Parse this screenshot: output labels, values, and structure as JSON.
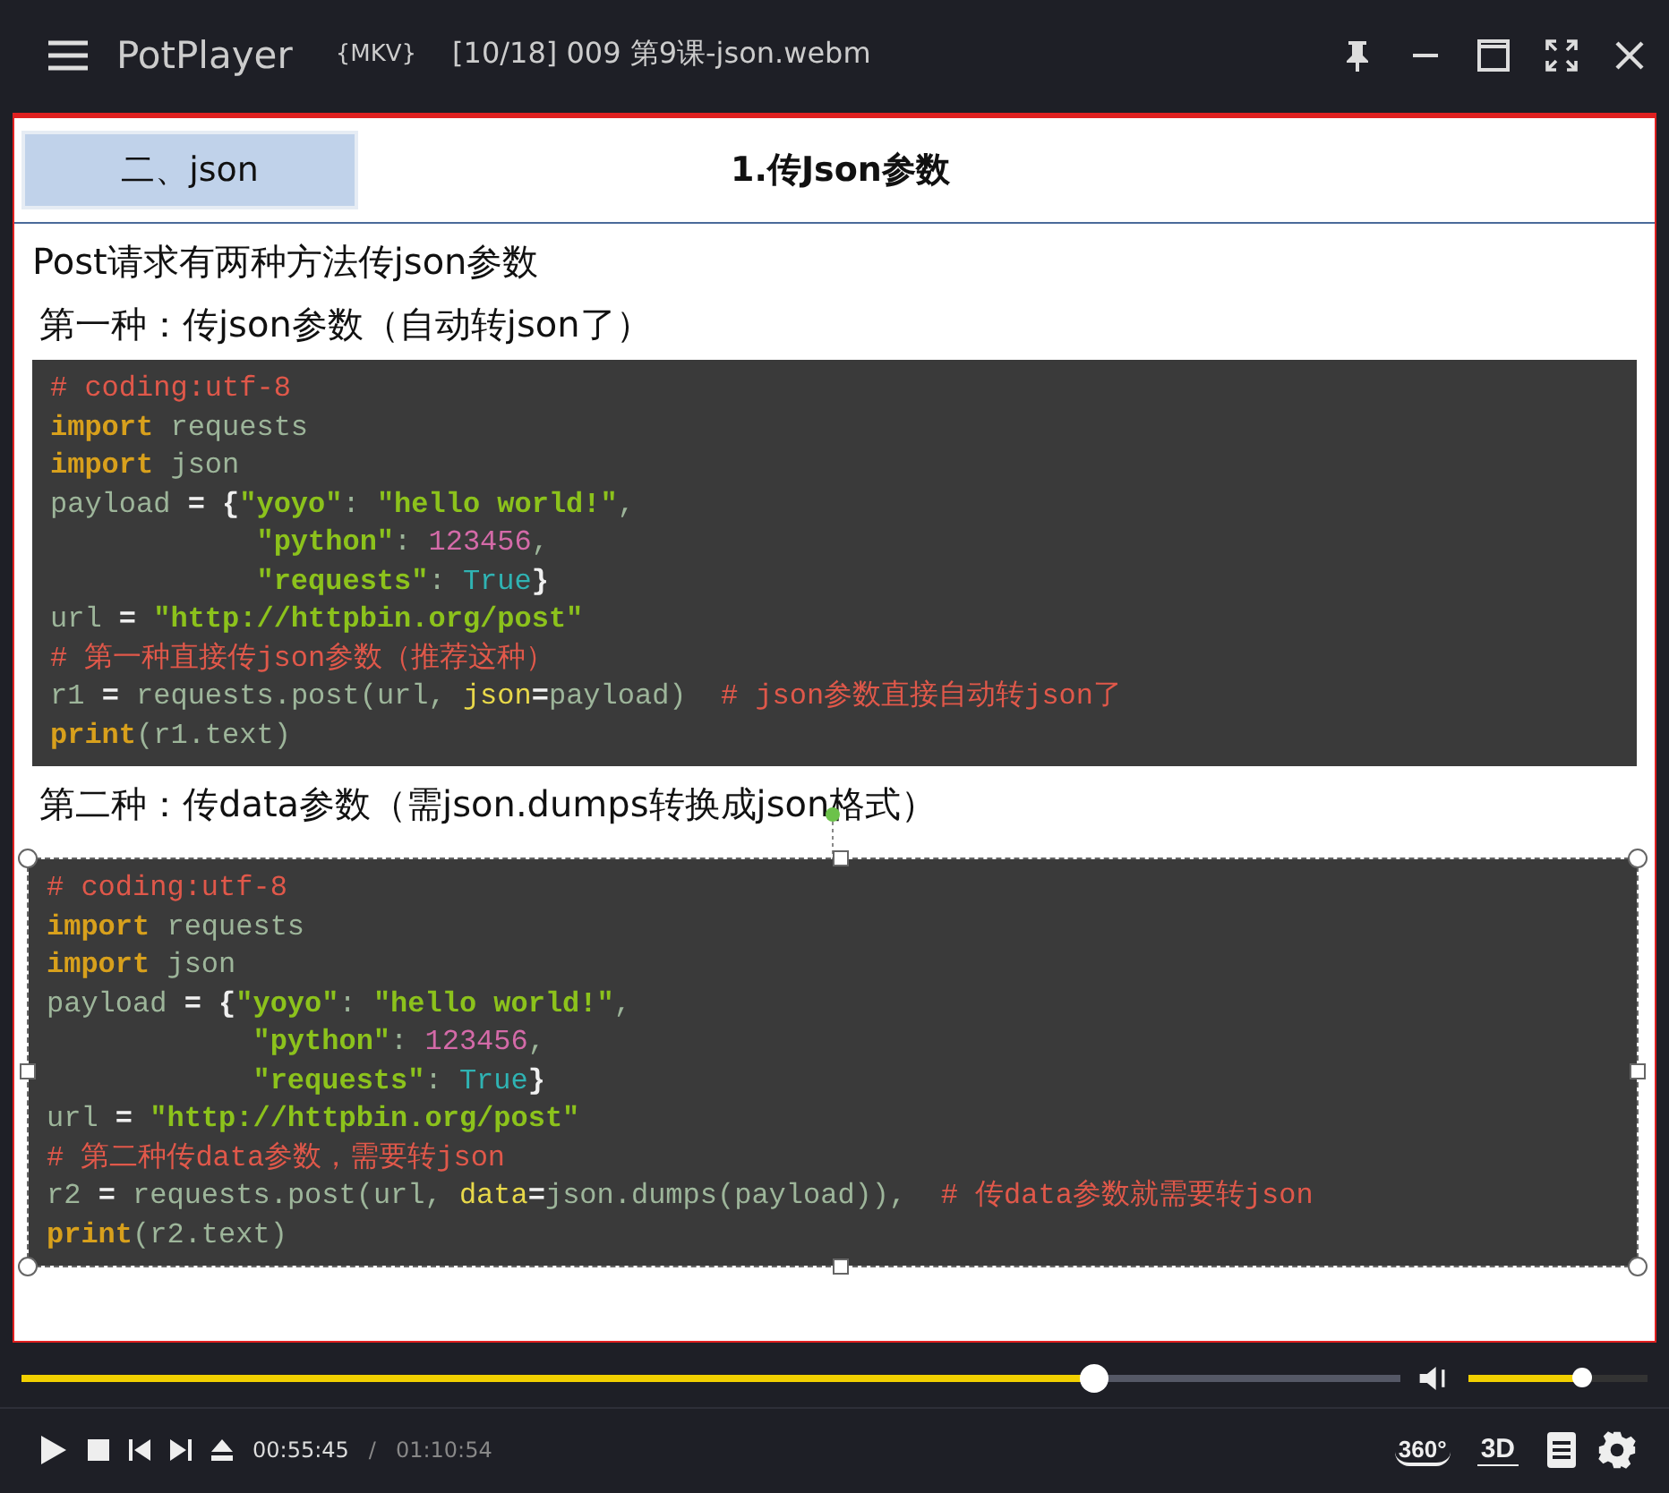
{
  "window": {
    "app_name": "PotPlayer",
    "format": "{MKV}",
    "title": "[10/18] 009 第9课-json.webm"
  },
  "slide": {
    "section": "二、json",
    "heading": "1.传Json参数",
    "intro": "Post请求有两种方法传json参数",
    "blocks": [
      {
        "label": "第一种：传json参数（自动转json了）",
        "selected": false,
        "lines": [
          {
            "indented": false,
            "tokens": [
              {
                "kind": "comment",
                "text": "# coding:utf-8"
              }
            ]
          },
          {
            "indented": false,
            "tokens": [
              {
                "kind": "keyword",
                "text": "import"
              },
              {
                "kind": "plain",
                "text": " requests"
              }
            ]
          },
          {
            "indented": false,
            "tokens": [
              {
                "kind": "keyword",
                "text": "import"
              },
              {
                "kind": "plain",
                "text": " json"
              }
            ]
          },
          {
            "indented": false,
            "tokens": [
              {
                "kind": "plain",
                "text": "payload "
              },
              {
                "kind": "operator",
                "text": "= {"
              },
              {
                "kind": "string",
                "text": "\"yoyo\""
              },
              {
                "kind": "plain",
                "text": ": "
              },
              {
                "kind": "string",
                "text": "\"hello world!\""
              },
              {
                "kind": "plain",
                "text": ","
              }
            ]
          },
          {
            "indented": true,
            "tokens": [
              {
                "kind": "string",
                "text": "\"python\""
              },
              {
                "kind": "plain",
                "text": ": "
              },
              {
                "kind": "number",
                "text": "123456"
              },
              {
                "kind": "plain",
                "text": ","
              }
            ]
          },
          {
            "indented": true,
            "tokens": [
              {
                "kind": "string",
                "text": "\"requests\""
              },
              {
                "kind": "plain",
                "text": ": "
              },
              {
                "kind": "constant",
                "text": "True"
              },
              {
                "kind": "operator",
                "text": "}"
              }
            ]
          },
          {
            "indented": false,
            "tokens": [
              {
                "kind": "plain",
                "text": "url "
              },
              {
                "kind": "operator",
                "text": "= "
              },
              {
                "kind": "string",
                "text": "\"http://httpbin.org/post\""
              }
            ]
          },
          {
            "indented": false,
            "tokens": [
              {
                "kind": "comment",
                "text": "# 第一种直接传json参数（推荐这种）"
              }
            ]
          },
          {
            "indented": false,
            "tokens": [
              {
                "kind": "plain",
                "text": "r1 "
              },
              {
                "kind": "operator",
                "text": "="
              },
              {
                "kind": "plain",
                "text": " requests.post(url, "
              },
              {
                "kind": "param",
                "text": "json"
              },
              {
                "kind": "operator",
                "text": "="
              },
              {
                "kind": "plain",
                "text": "payload)  "
              },
              {
                "kind": "comment",
                "text": "# json参数直接自动转json了"
              }
            ]
          },
          {
            "indented": false,
            "tokens": [
              {
                "kind": "keyword",
                "text": "print"
              },
              {
                "kind": "plain",
                "text": "(r1.text)"
              }
            ]
          }
        ]
      },
      {
        "label": "第二种：传data参数（需json.dumps转换成json格式）",
        "selected": true,
        "lines": [
          {
            "indented": false,
            "tokens": [
              {
                "kind": "comment",
                "text": "# coding:utf-8"
              }
            ]
          },
          {
            "indented": false,
            "tokens": [
              {
                "kind": "keyword",
                "text": "import"
              },
              {
                "kind": "plain",
                "text": " requests"
              }
            ]
          },
          {
            "indented": false,
            "tokens": [
              {
                "kind": "keyword",
                "text": "import"
              },
              {
                "kind": "plain",
                "text": " json"
              }
            ]
          },
          {
            "indented": false,
            "tokens": [
              {
                "kind": "plain",
                "text": "payload "
              },
              {
                "kind": "operator",
                "text": "= {"
              },
              {
                "kind": "string",
                "text": "\"yoyo\""
              },
              {
                "kind": "plain",
                "text": ": "
              },
              {
                "kind": "string",
                "text": "\"hello world!\""
              },
              {
                "kind": "plain",
                "text": ","
              }
            ]
          },
          {
            "indented": true,
            "tokens": [
              {
                "kind": "string",
                "text": "\"python\""
              },
              {
                "kind": "plain",
                "text": ": "
              },
              {
                "kind": "number",
                "text": "123456"
              },
              {
                "kind": "plain",
                "text": ","
              }
            ]
          },
          {
            "indented": true,
            "tokens": [
              {
                "kind": "string",
                "text": "\"requests\""
              },
              {
                "kind": "plain",
                "text": ": "
              },
              {
                "kind": "constant",
                "text": "True"
              },
              {
                "kind": "operator",
                "text": "}"
              }
            ]
          },
          {
            "indented": false,
            "tokens": [
              {
                "kind": "plain",
                "text": "url "
              },
              {
                "kind": "operator",
                "text": "= "
              },
              {
                "kind": "string",
                "text": "\"http://httpbin.org/post\""
              }
            ]
          },
          {
            "indented": false,
            "tokens": [
              {
                "kind": "comment",
                "text": "# 第二种传data参数，需要转json"
              }
            ]
          },
          {
            "indented": false,
            "tokens": [
              {
                "kind": "plain",
                "text": "r2 "
              },
              {
                "kind": "operator",
                "text": "="
              },
              {
                "kind": "plain",
                "text": " requests.post(url, "
              },
              {
                "kind": "param",
                "text": "data"
              },
              {
                "kind": "operator",
                "text": "="
              },
              {
                "kind": "plain",
                "text": "json.dumps(payload)),  "
              },
              {
                "kind": "comment",
                "text": "# 传data参数就需要转json"
              }
            ]
          },
          {
            "indented": false,
            "tokens": [
              {
                "kind": "keyword",
                "text": "print"
              },
              {
                "kind": "plain",
                "text": "(r2.text)"
              }
            ]
          }
        ]
      }
    ]
  },
  "seek": {
    "level": 0.778
  },
  "volume": {
    "level": 0.63
  },
  "time": {
    "current": "00:55:45",
    "separator": "/",
    "total": "01:10:54"
  },
  "badges": {
    "vr": "360°",
    "stereo": "3D"
  }
}
